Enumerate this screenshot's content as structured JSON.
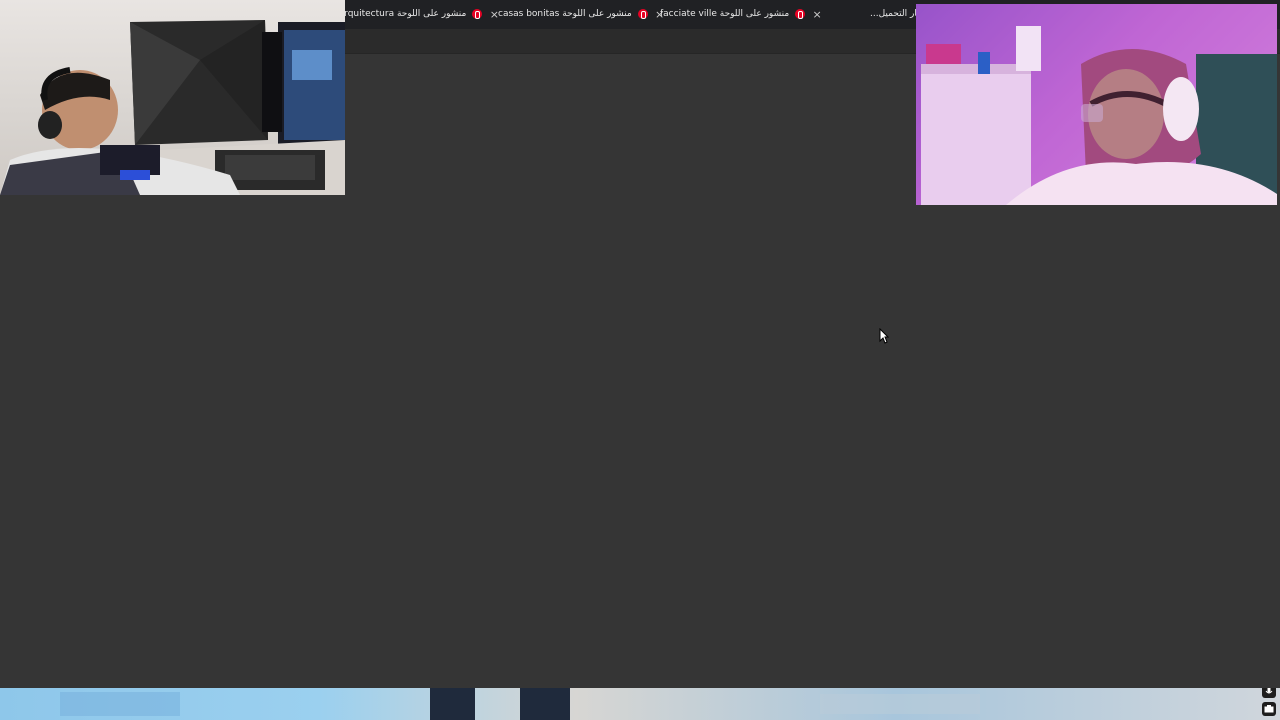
{
  "tabs": [
    {
      "title": "Arquitectura منشور على اللوحة"
    },
    {
      "title": "casas bonitas منشور على اللوحة"
    },
    {
      "title": "facciate ville منشور على اللوحة"
    },
    {
      "title": "...جار التحميل"
    }
  ],
  "icons": {
    "close": "×",
    "pinterest": "pinterest-icon",
    "mic": "microphone-icon",
    "camera": "camera-icon",
    "cursor": "mouse-pointer-icon"
  },
  "colors": {
    "page_bg": "#353535",
    "tabstrip_bg": "#202124",
    "pinterest_red": "#e60023"
  }
}
